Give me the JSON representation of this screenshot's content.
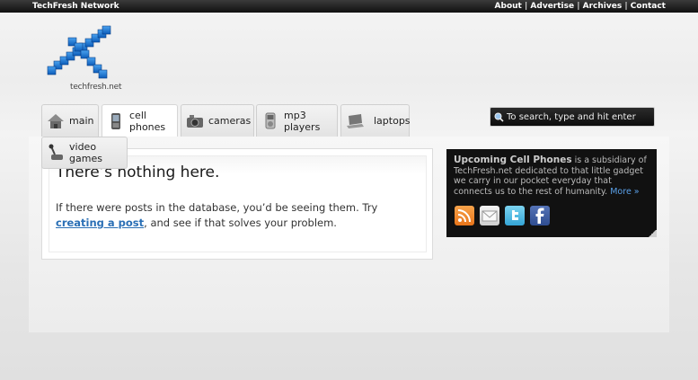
{
  "topbar": {
    "network": "TechFresh Network",
    "links": [
      "About",
      "Advertise",
      "Archives",
      "Contact"
    ],
    "separator": " | "
  },
  "logo": {
    "text": "techfresh.net"
  },
  "nav": {
    "tabs": [
      {
        "label": "main",
        "icon": "house-icon",
        "active": false
      },
      {
        "label": "cell phones",
        "icon": "phone-icon",
        "active": true
      },
      {
        "label": "cameras",
        "icon": "camera-icon",
        "active": false
      },
      {
        "label": "mp3 players",
        "icon": "mp3-player-icon",
        "active": false
      },
      {
        "label": "laptops",
        "icon": "laptop-icon",
        "active": false
      },
      {
        "label": "video games",
        "icon": "joystick-icon",
        "active": false
      }
    ]
  },
  "search": {
    "placeholder": "To search, type and hit enter"
  },
  "post": {
    "title": "There’s nothing here.",
    "body_before": "If there were posts in the database, you’d be seeing them. Try ",
    "link_text": "creating a post",
    "body_after": ", and see if that solves your problem."
  },
  "sidebar": {
    "title": "Upcoming Cell Phones",
    "text": " is a subsidiary of TechFresh.net dedicated to that little gadget we carry in our pocket everyday that connects us to the rest of humanity. ",
    "more_link": "More »",
    "social": [
      "rss-icon",
      "email-icon",
      "twitter-icon",
      "facebook-icon"
    ]
  },
  "colors": {
    "topbar": "#111111",
    "link": "#2a6fb5",
    "sidebar_bg": "#111111",
    "sidebar_link": "#5aa0e8"
  }
}
